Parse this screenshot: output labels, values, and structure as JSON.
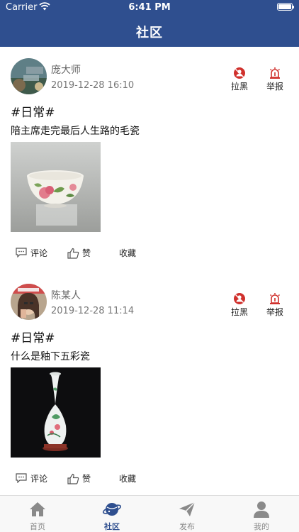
{
  "status_bar": {
    "carrier": "Carrier",
    "time": "6:41 PM"
  },
  "header": {
    "title": "社区"
  },
  "posts": [
    {
      "author": "庞大师",
      "time": "2019-12-28 16:10",
      "tag": "#日常#",
      "content": "陪主席走完最后人生路的毛瓷",
      "block_label": "拉黑",
      "report_label": "举报",
      "comment_label": "评论",
      "like_label": "赞",
      "favorite_label": "收藏"
    },
    {
      "author": "陈某人",
      "time": "2019-12-28 11:14",
      "tag": "#日常#",
      "content": "什么是釉下五彩瓷",
      "block_label": "拉黑",
      "report_label": "举报",
      "comment_label": "评论",
      "like_label": "赞",
      "favorite_label": "收藏"
    }
  ],
  "tabbar": {
    "items": [
      {
        "label": "首页",
        "icon": "home-icon"
      },
      {
        "label": "社区",
        "icon": "planet-icon",
        "active": true
      },
      {
        "label": "发布",
        "icon": "send-icon"
      },
      {
        "label": "我的",
        "icon": "person-icon"
      }
    ]
  },
  "colors": {
    "header": "#2f4f8f",
    "accent_red": "#d0312d",
    "tab_active": "#2f4f8f",
    "tab_inactive": "#8a8a8a"
  }
}
